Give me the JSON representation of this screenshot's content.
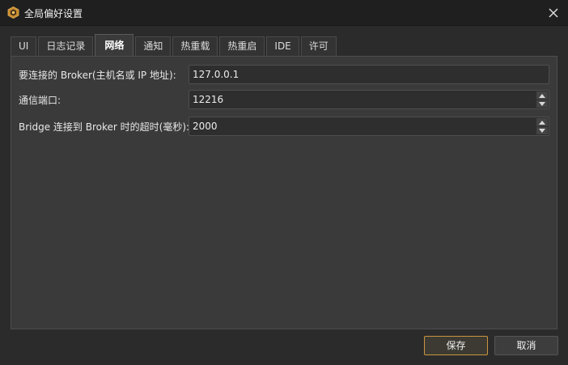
{
  "window": {
    "title": "全局偏好设置",
    "accent_color": "#c9953f"
  },
  "tabs": [
    {
      "label": "UI",
      "active": false
    },
    {
      "label": "日志记录",
      "active": false
    },
    {
      "label": "网络",
      "active": true
    },
    {
      "label": "通知",
      "active": false
    },
    {
      "label": "热重载",
      "active": false
    },
    {
      "label": "热重启",
      "active": false
    },
    {
      "label": "IDE",
      "active": false
    },
    {
      "label": "许可",
      "active": false
    }
  ],
  "network": {
    "broker_host_label": "要连接的 Broker(主机名或 IP 地址):",
    "broker_host_value": "127.0.0.1",
    "port_label": "通信端口:",
    "port_value": "12216",
    "timeout_label": "Bridge 连接到 Broker 时的超时(毫秒):",
    "timeout_value": "2000"
  },
  "buttons": {
    "save": "保存",
    "cancel": "取消"
  }
}
